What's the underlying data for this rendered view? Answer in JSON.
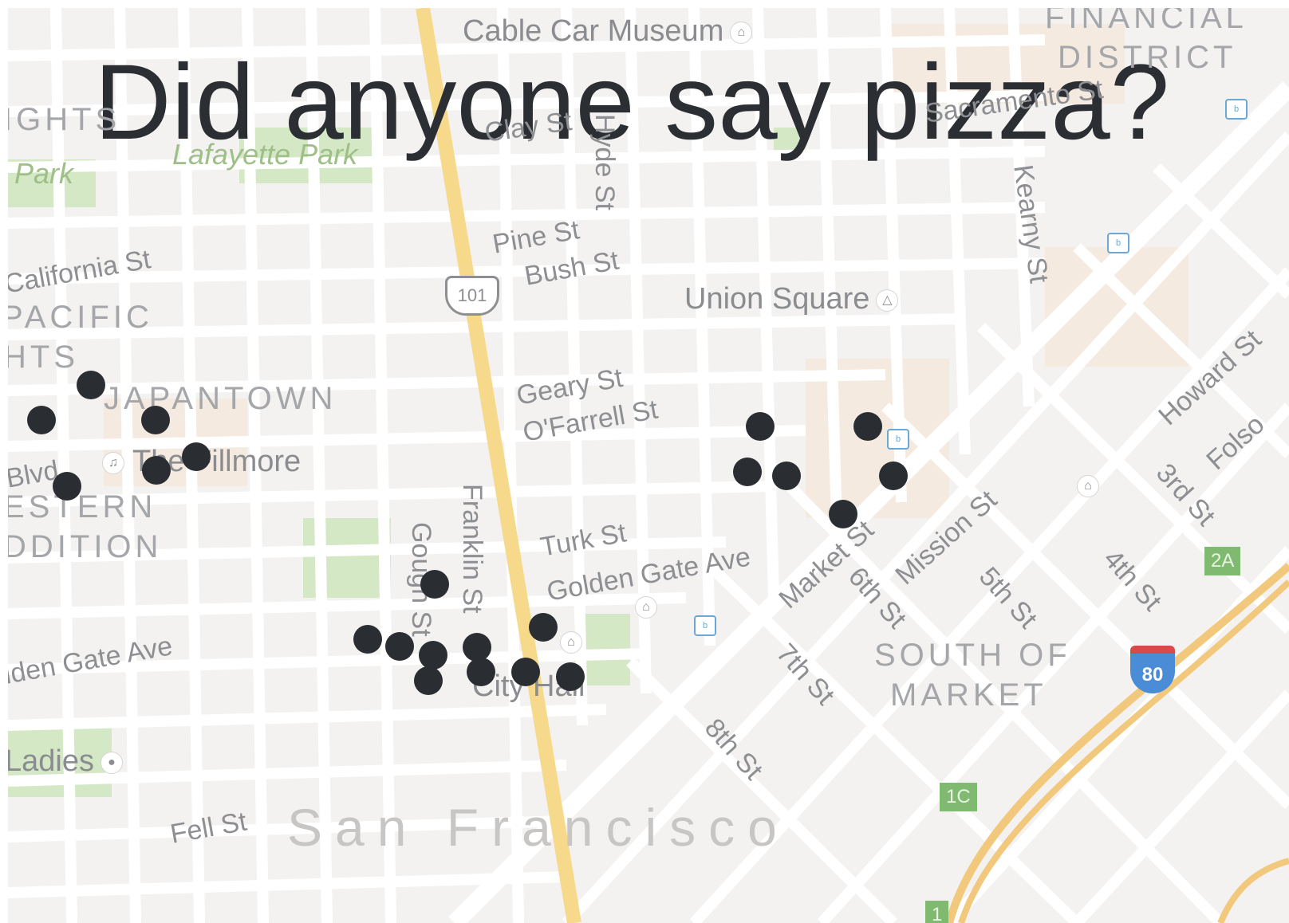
{
  "headline": "Did anyone say pizza?",
  "city_name": "San Francisco",
  "colors": {
    "pin": "#2a2d32",
    "highway": "#f6d98a",
    "park": "#d5e8c6",
    "map_background": "#f3f2f0"
  },
  "neighborhoods": {
    "financial_line1": "FINANCIAL",
    "financial_line2": "DISTRICT",
    "heights_line1": "IGHTS",
    "pacific_line1": "PACIFIC",
    "pacific_line2": "HTS",
    "japantown": "JAPANTOWN",
    "western_line1": "ESTERN",
    "western_line2": "DDITION",
    "soma_line1": "SOUTH OF",
    "soma_line2": "MARKET"
  },
  "parks": {
    "lafayette": "Lafayette Park",
    "alta": "Park"
  },
  "pois": {
    "cable_car_museum": "Cable Car Museum",
    "union_square": "Union Square",
    "fillmore": "The Fillmore",
    "city_hall": "City Hall",
    "painted_ladies": "Ladies"
  },
  "streets": {
    "clay": "Clay St",
    "hyde": "Hyde St",
    "sacramento": "Sacramento St",
    "california": "California St",
    "pine": "Pine St",
    "bush": "Bush St",
    "kearny": "Kearny St",
    "geary": "Geary St",
    "ofarrell": "O'Farrell St",
    "geary_blvd": "Blvd",
    "franklin": "Franklin St",
    "gough": "Gough St",
    "turk": "Turk St",
    "golden_gate_ave": "Golden Gate Ave",
    "golden_gate_ave_west": "lden Gate Ave",
    "market": "Market St",
    "mission": "Mission St",
    "sixth": "6th St",
    "fifth": "5th St",
    "fourth": "4th St",
    "third": "3rd St",
    "seventh": "7th St",
    "eighth": "8th St",
    "howard": "Howard St",
    "folsom": "Folso",
    "fell": "Fell St"
  },
  "shields": {
    "us101": "101",
    "i80": "80"
  },
  "exits": {
    "exit_2a": "2A",
    "exit_1c": "1C",
    "exit_1": "1"
  },
  "pins_note_free": true,
  "pizza_places": [
    {
      "lon": 0.065,
      "lat": 0.412
    },
    {
      "lon": 0.026,
      "lat": 0.45
    },
    {
      "lon": 0.115,
      "lat": 0.45
    },
    {
      "lon": 0.147,
      "lat": 0.49
    },
    {
      "lon": 0.116,
      "lat": 0.505
    },
    {
      "lon": 0.046,
      "lat": 0.523
    },
    {
      "lon": 0.333,
      "lat": 0.63
    },
    {
      "lon": 0.281,
      "lat": 0.69
    },
    {
      "lon": 0.306,
      "lat": 0.698
    },
    {
      "lon": 0.332,
      "lat": 0.707
    },
    {
      "lon": 0.328,
      "lat": 0.735
    },
    {
      "lon": 0.366,
      "lat": 0.699
    },
    {
      "lon": 0.369,
      "lat": 0.726
    },
    {
      "lon": 0.404,
      "lat": 0.726
    },
    {
      "lon": 0.418,
      "lat": 0.677
    },
    {
      "lon": 0.439,
      "lat": 0.731
    },
    {
      "lon": 0.587,
      "lat": 0.457
    },
    {
      "lon": 0.671,
      "lat": 0.457
    },
    {
      "lon": 0.577,
      "lat": 0.507
    },
    {
      "lon": 0.608,
      "lat": 0.511
    },
    {
      "lon": 0.691,
      "lat": 0.511
    },
    {
      "lon": 0.652,
      "lat": 0.553
    }
  ]
}
